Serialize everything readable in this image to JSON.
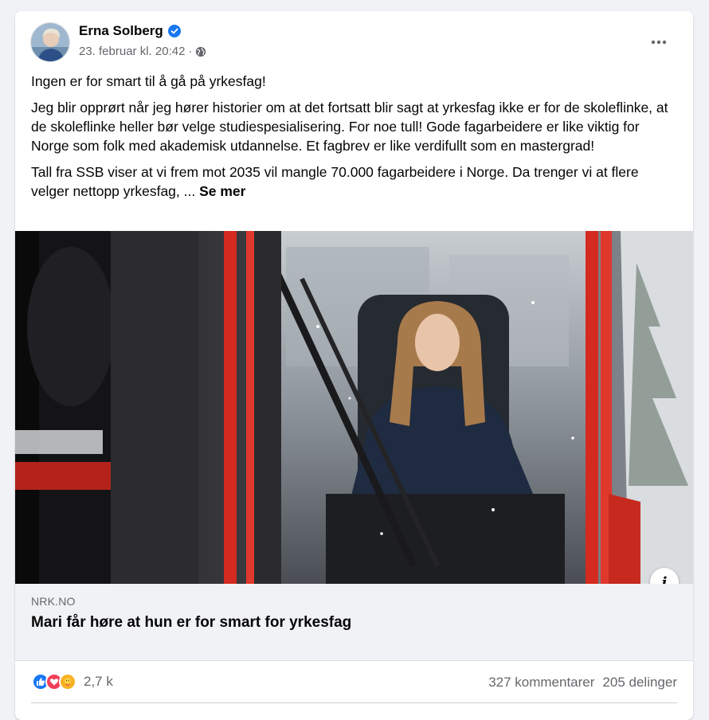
{
  "post": {
    "author": "Erna Solberg",
    "timestamp": "23. februar kl. 20:42",
    "separator": "·",
    "paragraphs": [
      "Ingen er for smart til å gå på yrkesfag!",
      "Jeg blir opprørt når jeg hører historier om at det fortsatt blir sagt at yrkesfag ikke er for de skoleflinke, at de skoleflinke heller bør velge studiespesialisering. For noe tull! Gode fagarbeidere er like viktig for Norge som folk med akademisk utdannelse. Et fagbrev er like verdifullt som en mastergrad!",
      "Tall fra SSB viser at vi frem mot 2035 vil mangle 70.000 fagarbeidere i Norge. Da trenger vi at flere velger nettopp yrkesfag, ..."
    ],
    "see_more": "Se mer"
  },
  "link": {
    "domain": "NRK.NO",
    "title": "Mari får høre at hun er for smart for yrkesfag",
    "info_glyph": "i"
  },
  "stats": {
    "reactions_count": "2,7 k",
    "comments": "327 kommentarer",
    "shares": "205 delinger",
    "reaction_icons": [
      "like-icon",
      "love-icon",
      "care-icon"
    ]
  },
  "colors": {
    "verified": "#1877f2",
    "like": "#1877f2",
    "love": "#f33e58",
    "care": "#f7b125",
    "machine_red": "#d42a1f"
  }
}
